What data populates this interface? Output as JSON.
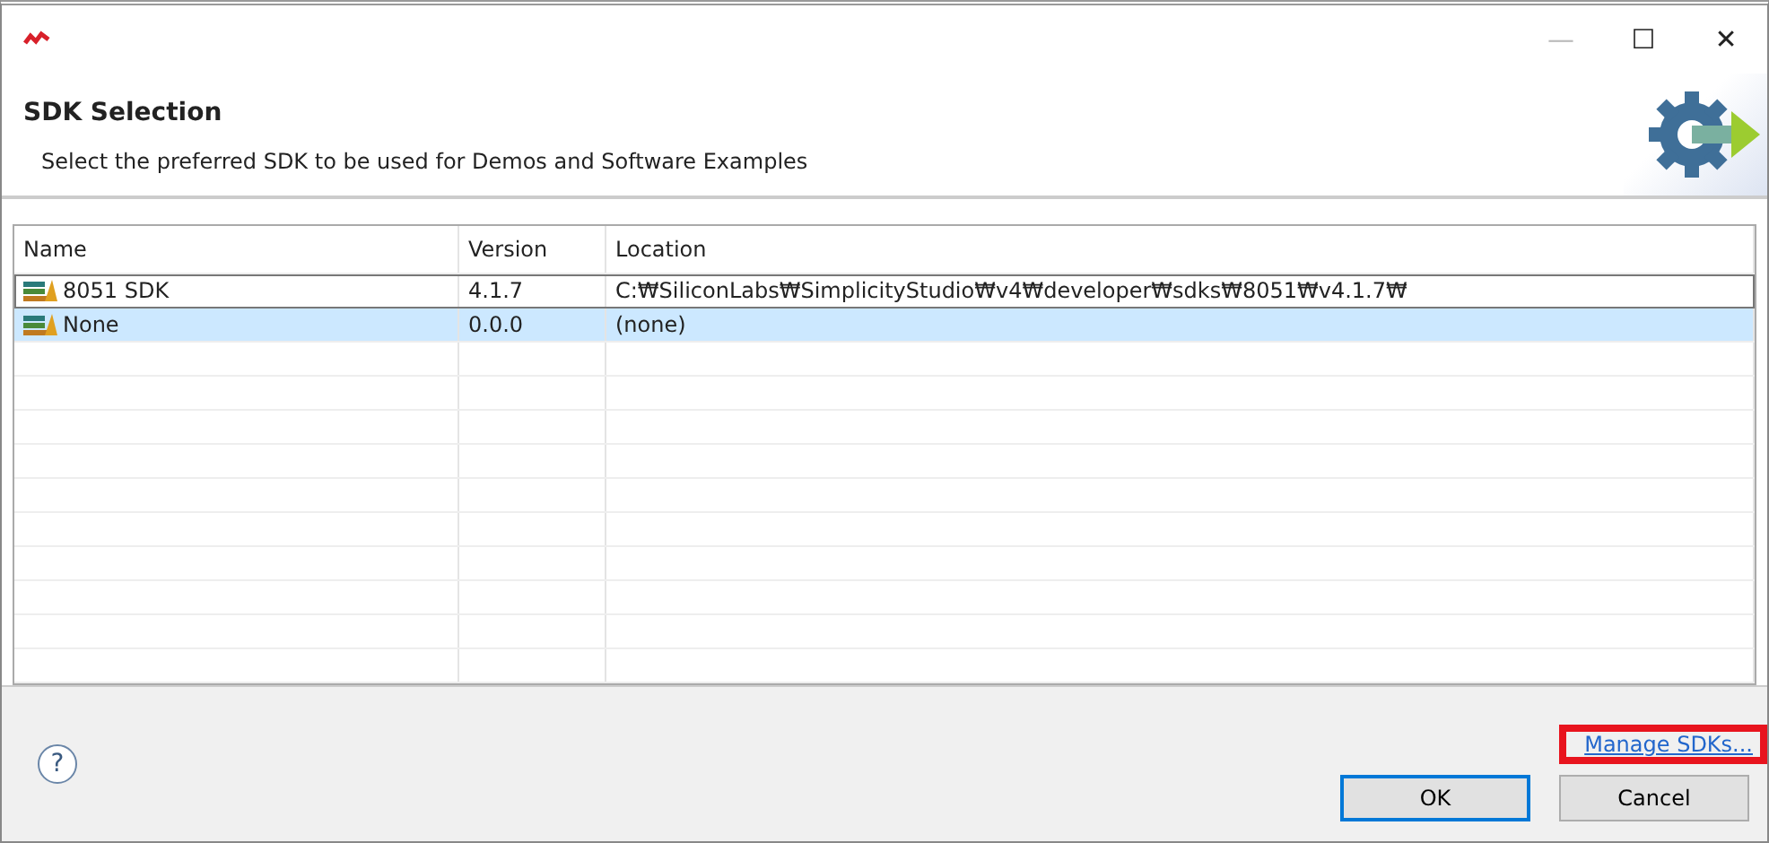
{
  "window": {
    "title_buttons": [
      "—",
      "☐",
      "✕"
    ]
  },
  "header": {
    "title": "SDK Selection",
    "description": "Select the preferred SDK to be used for Demos and Software Examples"
  },
  "table": {
    "columns": [
      "Name",
      "Version",
      "Location"
    ],
    "rows": [
      {
        "name": "8051 SDK",
        "version": "4.1.7",
        "location": "C:₩SiliconLabs₩SimplicityStudio₩v4₩developer₩sdks₩8051₩v4.1.7₩",
        "selected": false,
        "focused": true
      },
      {
        "name": "None",
        "version": "0.0.0",
        "location": "(none)",
        "selected": true,
        "focused": false
      }
    ]
  },
  "footer": {
    "help": "?",
    "link": "Manage SDKs...",
    "buttons": [
      {
        "label": "OK",
        "default": true
      },
      {
        "label": "Cancel",
        "default": false
      }
    ]
  }
}
